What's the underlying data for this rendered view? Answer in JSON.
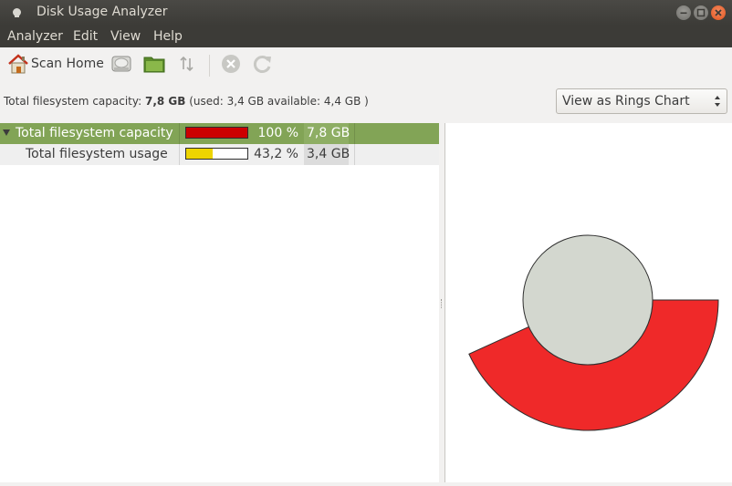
{
  "window": {
    "title": "Disk Usage Analyzer"
  },
  "menu": [
    "Analyzer",
    "Edit",
    "View",
    "Help"
  ],
  "toolbar": {
    "scan_home_label": "Scan Home"
  },
  "info": {
    "prefix": "Total filesystem capacity: ",
    "capacity": "7,8 GB",
    "suffix": " (used: 3,4 GB available: 4,4 GB )"
  },
  "view_selector": {
    "selected": "View as Rings Chart"
  },
  "tree": [
    {
      "name": "Total filesystem capacity",
      "percent": "100 %",
      "size": "7,8 GB",
      "fill": 1.0,
      "bar_color": "#cc0000",
      "expanded": true,
      "selected": true
    },
    {
      "name": "Total filesystem usage",
      "percent": "43,2 %",
      "size": "3,4 GB",
      "fill": 0.432,
      "bar_color": "#edd400",
      "expanded": false,
      "selected": false
    }
  ],
  "rings_chart": {
    "center_color": "#d3d7cf",
    "ring_color": "#ef2929",
    "used_fraction": 0.432
  }
}
